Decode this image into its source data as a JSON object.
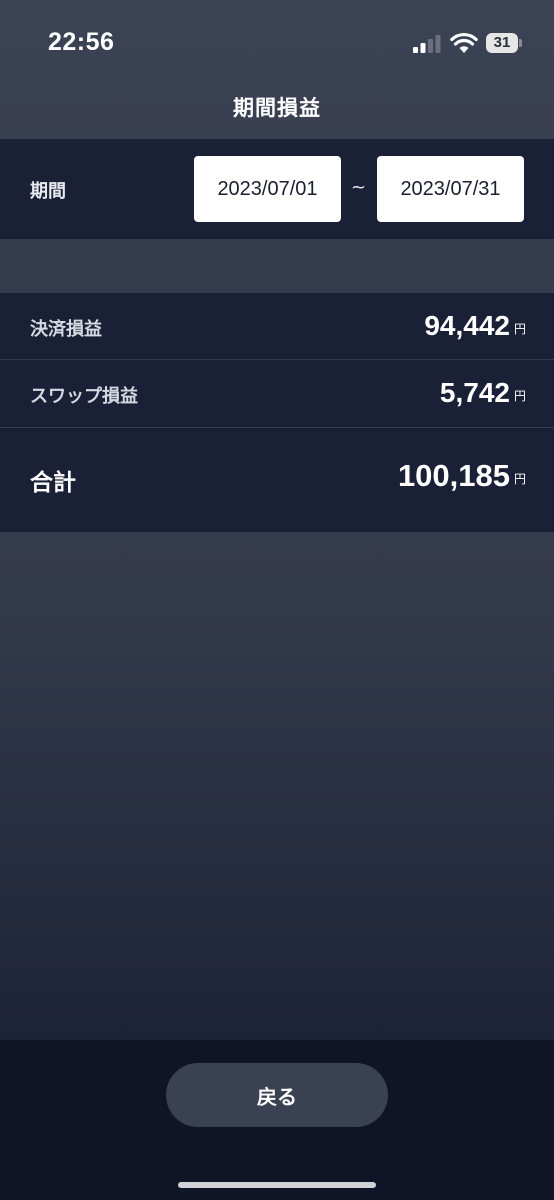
{
  "status_bar": {
    "time": "22:56",
    "battery": "31",
    "icons": [
      "signal-icon",
      "wifi-icon",
      "battery-icon"
    ]
  },
  "header": {
    "title": "期間損益"
  },
  "period": {
    "label": "期間",
    "from": "2023/07/01",
    "separator": "~",
    "to": "2023/07/31"
  },
  "summary": {
    "rows": [
      {
        "label": "決済損益",
        "value": "94,442",
        "unit": "円"
      },
      {
        "label": "スワップ損益",
        "value": "5,742",
        "unit": "円"
      },
      {
        "label": "合計",
        "value": "100,185",
        "unit": "円"
      }
    ]
  },
  "footer": {
    "back_label": "戻る"
  },
  "colors": {
    "panel": "#1a2035",
    "background": "#3b4254",
    "footer": "#0f1527",
    "button": "#3a4152"
  }
}
